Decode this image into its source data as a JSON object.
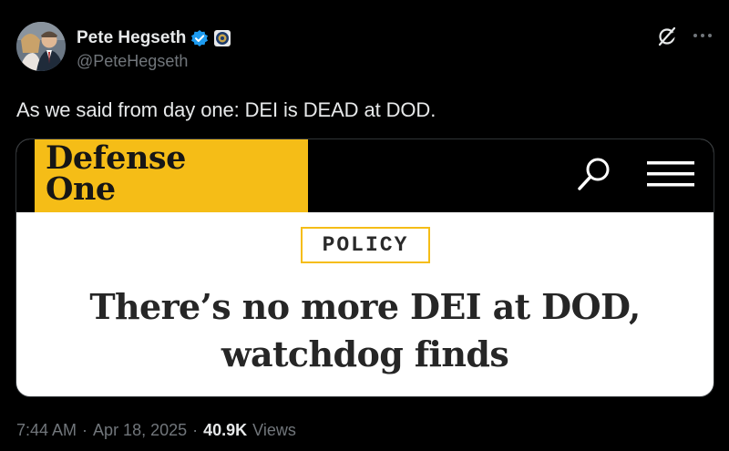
{
  "author": {
    "name": "Pete Hegseth",
    "handle": "@PeteHegseth"
  },
  "tweet": {
    "text": "As we said from day one: DEI is DEAD at DOD."
  },
  "card": {
    "logo_line1": "Defense",
    "logo_line2": "One",
    "category": "POLICY",
    "headline_line1": "There’s no more DEI at DOD,",
    "headline_line2": "watchdog finds"
  },
  "meta": {
    "time": "7:44 AM",
    "sep1": "·",
    "date": "Apr 18, 2025",
    "sep2": "·",
    "views_count": "40.9K",
    "views_label": "Views"
  },
  "colors": {
    "background": "#000000",
    "text_primary": "#e7e9ea",
    "text_secondary": "#71767b",
    "verified_blue": "#1d9bf0",
    "brand_yellow": "#f5bd17"
  },
  "icons": [
    "verified-badge-icon",
    "affiliate-seal-icon",
    "grok-icon",
    "more-icon",
    "search-icon",
    "menu-icon"
  ]
}
